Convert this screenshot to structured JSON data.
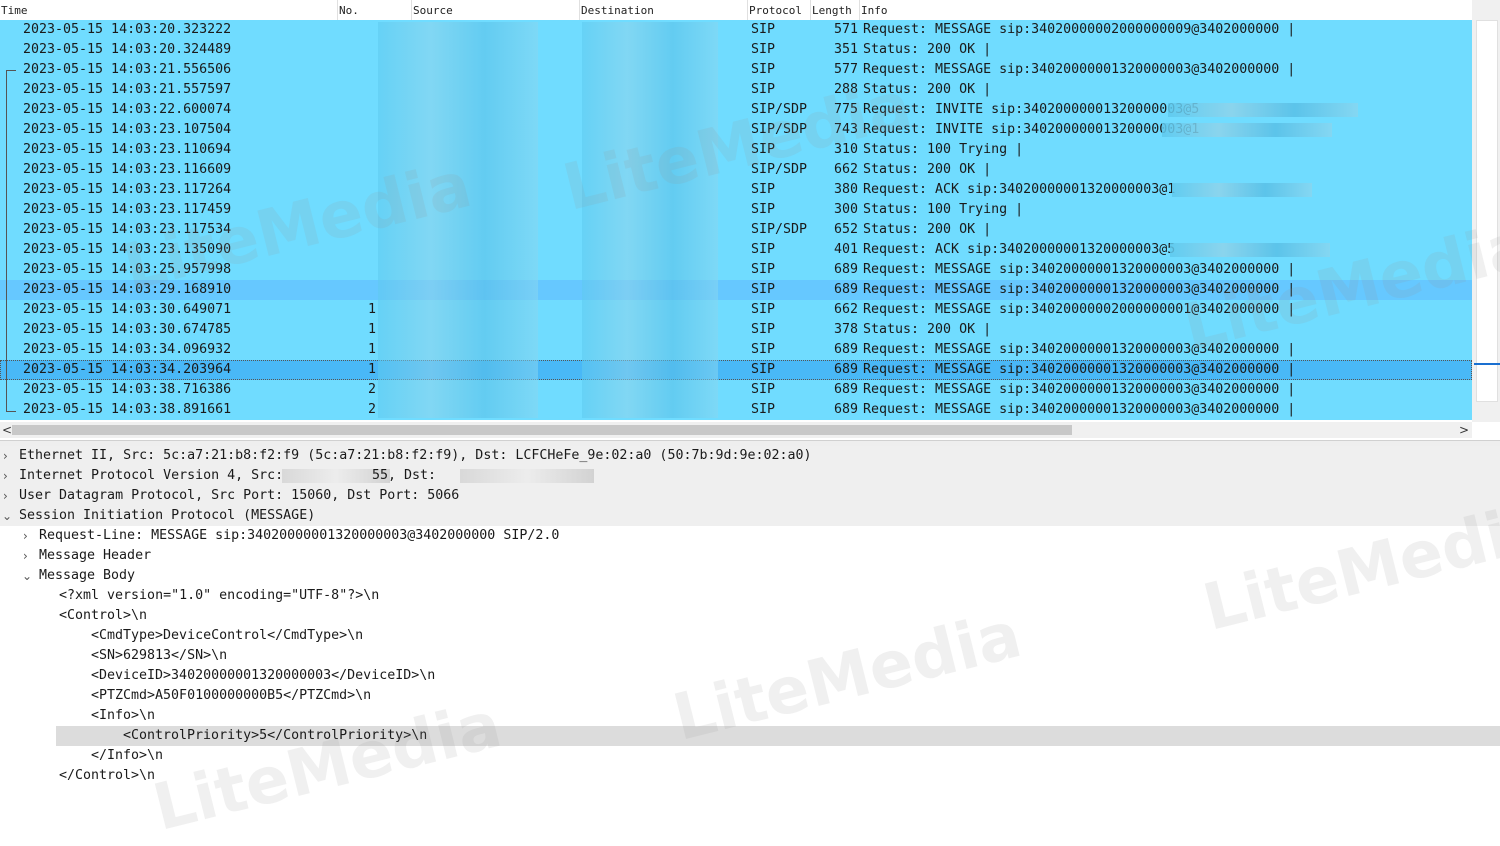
{
  "columns": {
    "time": "Time",
    "no": "No.",
    "source": "Source",
    "destination": "Destination",
    "protocol": "Protocol",
    "length": "Length",
    "info": "Info"
  },
  "packets": [
    {
      "time": "2023-05-15 14:03:20.323222",
      "no": "",
      "protocol": "SIP",
      "length": "571",
      "info": "Request: MESSAGE sip:34020000002000000009@3402000000 |"
    },
    {
      "time": "2023-05-15 14:03:20.324489",
      "no": "",
      "protocol": "SIP",
      "length": "351",
      "info": "Status: 200 OK |"
    },
    {
      "time": "2023-05-15 14:03:21.556506",
      "no": "",
      "protocol": "SIP",
      "length": "577",
      "info": "Request: MESSAGE sip:34020000001320000003@3402000000 |"
    },
    {
      "time": "2023-05-15 14:03:21.557597",
      "no": "",
      "protocol": "SIP",
      "length": "288",
      "info": "Status: 200 OK |"
    },
    {
      "time": "2023-05-15 14:03:22.600074",
      "no": "",
      "protocol": "SIP/SDP",
      "length": "775",
      "info": "Request: INVITE sip:34020000001320000003@5"
    },
    {
      "time": "2023-05-15 14:03:23.107504",
      "no": "",
      "protocol": "SIP/SDP",
      "length": "743",
      "info": "Request: INVITE sip:34020000001320000003@1"
    },
    {
      "time": "2023-05-15 14:03:23.110694",
      "no": "",
      "protocol": "SIP",
      "length": "310",
      "info": "Status: 100 Trying |"
    },
    {
      "time": "2023-05-15 14:03:23.116609",
      "no": "",
      "protocol": "SIP/SDP",
      "length": "662",
      "info": "Status: 200 OK |"
    },
    {
      "time": "2023-05-15 14:03:23.117264",
      "no": "",
      "protocol": "SIP",
      "length": "380",
      "info": "Request: ACK sip:34020000001320000003@1"
    },
    {
      "time": "2023-05-15 14:03:23.117459",
      "no": "",
      "protocol": "SIP",
      "length": "300",
      "info": "Status: 100 Trying |"
    },
    {
      "time": "2023-05-15 14:03:23.117534",
      "no": "",
      "protocol": "SIP/SDP",
      "length": "652",
      "info": "Status: 200 OK |"
    },
    {
      "time": "2023-05-15 14:03:23.135090",
      "no": "",
      "protocol": "SIP",
      "length": "401",
      "info": "Request: ACK sip:34020000001320000003@5"
    },
    {
      "time": "2023-05-15 14:03:25.957998",
      "no": "",
      "protocol": "SIP",
      "length": "689",
      "info": "Request: MESSAGE sip:34020000001320000003@3402000000 |"
    },
    {
      "time": "2023-05-15 14:03:29.168910",
      "no": "",
      "protocol": "SIP",
      "length": "689",
      "info": "Request: MESSAGE sip:34020000001320000003@3402000000 |"
    },
    {
      "time": "2023-05-15 14:03:30.649071",
      "no": "1",
      "protocol": "SIP",
      "length": "662",
      "info": "Request: MESSAGE sip:34020000002000000001@3402000000 |"
    },
    {
      "time": "2023-05-15 14:03:30.674785",
      "no": "1",
      "protocol": "SIP",
      "length": "378",
      "info": "Status: 200 OK |"
    },
    {
      "time": "2023-05-15 14:03:34.096932",
      "no": "1",
      "protocol": "SIP",
      "length": "689",
      "info": "Request: MESSAGE sip:34020000001320000003@3402000000 |"
    },
    {
      "time": "2023-05-15 14:03:34.203964",
      "no": "1",
      "protocol": "SIP",
      "length": "689",
      "info": "Request: MESSAGE sip:34020000001320000003@3402000000 |"
    },
    {
      "time": "2023-05-15 14:03:38.716386",
      "no": "2",
      "protocol": "SIP",
      "length": "689",
      "info": "Request: MESSAGE sip:34020000001320000003@3402000000 |"
    },
    {
      "time": "2023-05-15 14:03:38.891661",
      "no": "2",
      "protocol": "SIP",
      "length": "689",
      "info": "Request: MESSAGE sip:34020000001320000003@3402000000 |"
    }
  ],
  "details": {
    "ethernet": "Ethernet II, Src: 5c:a7:21:b8:f2:f9 (5c:a7:21:b8:f2:f9), Dst: LCFCHeFe_9e:02:a0 (50:7b:9d:9e:02:a0)",
    "ip_prefix": "Internet Protocol Version 4, Src: ",
    "ip_src_tail": "55, Dst:",
    "udp": "User Datagram Protocol, Src Port: 15060, Dst Port: 5066",
    "sip": "Session Initiation Protocol (MESSAGE)",
    "request_line": "Request-Line: MESSAGE sip:34020000001320000003@3402000000 SIP/2.0",
    "message_header": "Message Header",
    "message_body": "Message Body",
    "body_lines": [
      "<?xml version=\"1.0\" encoding=\"UTF-8\"?>\\n",
      "<Control>\\n",
      "<CmdType>DeviceControl</CmdType>\\n",
      "<SN>629813</SN>\\n",
      "<DeviceID>34020000001320000003</DeviceID>\\n",
      "<PTZCmd>A50F0100000000B5</PTZCmd>\\n",
      "<Info>\\n",
      "<ControlPriority>5</ControlPriority>\\n",
      "</Info>\\n",
      "</Control>\\n"
    ]
  },
  "watermark": "LiteMedia",
  "icons": {
    "collapsed": "chevron-right-icon",
    "expanded": "chevron-down-icon",
    "scroll_left": "arrow-left-icon",
    "scroll_right": "arrow-right-icon"
  },
  "colors": {
    "row_bg": "#70dcff",
    "selected_row_bg": "#49b8f7",
    "highlight_detail": "#dcdcdc"
  }
}
